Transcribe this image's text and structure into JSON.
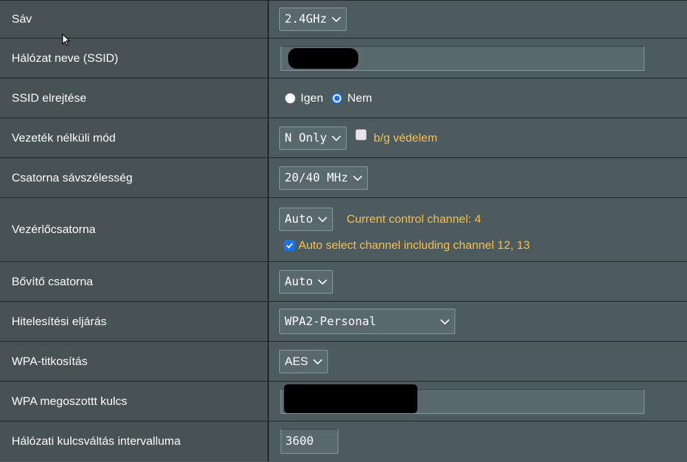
{
  "rows": {
    "band": {
      "label": "Sáv",
      "value": "2.4GHz"
    },
    "ssid": {
      "label": "Hálózat neve (SSID)",
      "value": ""
    },
    "hide_ssid": {
      "label": "SSID elrejtése",
      "option_yes": "Igen",
      "option_no": "Nem",
      "selected": "Nem"
    },
    "wireless_mode": {
      "label": "Vezeték nélküli mód",
      "value": "N Only",
      "checkbox_label": "b/g védelem",
      "checkbox_checked": false
    },
    "bandwidth": {
      "label": "Csatorna sávszélesség",
      "value": "20/40 MHz"
    },
    "control_channel": {
      "label": "Vezérlőcsatorna",
      "value": "Auto",
      "status": "Current control channel: 4",
      "checkbox_label": "Auto select channel including channel 12, 13",
      "checkbox_checked": true
    },
    "ext_channel": {
      "label": "Bővítő csatorna",
      "value": "Auto"
    },
    "auth": {
      "label": "Hitelesítési eljárás",
      "value": "WPA2-Personal"
    },
    "wpa_enc": {
      "label": "WPA-titkosítás",
      "value": "AES"
    },
    "wpa_key": {
      "label": "WPA megoszottt kulcs",
      "value": ""
    },
    "rekey": {
      "label": "Hálózati kulcsváltás intervalluma",
      "value": "3600"
    }
  },
  "colors": {
    "label_bg": "#475255",
    "value_bg": "#4d5b5f",
    "accent_yellow": "#f5c04a",
    "checkbox_blue": "#1a73e8"
  }
}
